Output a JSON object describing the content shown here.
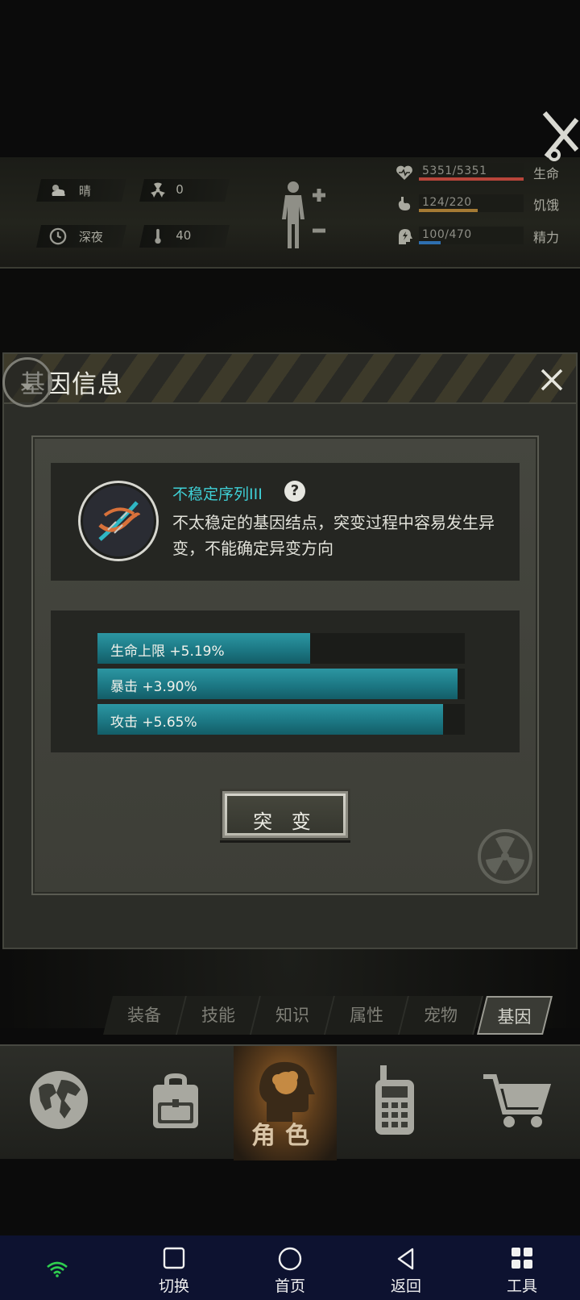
{
  "hud": {
    "weather": "晴",
    "radiation": "0",
    "time_of_day": "深夜",
    "temperature": "40",
    "life": {
      "value": "5351/5351",
      "label": "生命",
      "fill": 1.0,
      "color": "#b8453a"
    },
    "hunger": {
      "value": "124/220",
      "label": "饥饿",
      "fill": 0.56,
      "color": "#a47a34"
    },
    "energy": {
      "value": "100/470",
      "label": "精力",
      "fill": 0.21,
      "color": "#2e6fb0"
    }
  },
  "dialog": {
    "title": "基因信息",
    "gene": {
      "name": "不稳定序列III",
      "description": "不太稳定的基因结点，突变过程中容易发生异变，不能确定异变方向"
    },
    "stats": [
      {
        "label": "生命上限 +5.19%",
        "fill": 0.58
      },
      {
        "label": "暴击 +3.90%",
        "fill": 0.98
      },
      {
        "label": "攻击 +5.65%",
        "fill": 0.94
      }
    ],
    "mutate_label": "突 变"
  },
  "tabs": [
    {
      "label": "装备"
    },
    {
      "label": "技能"
    },
    {
      "label": "知识"
    },
    {
      "label": "属性"
    },
    {
      "label": "宠物"
    },
    {
      "label": "基因",
      "active": true
    }
  ],
  "bottom_nav": {
    "character_label": "角色"
  },
  "system_bar": {
    "switch": "切换",
    "home": "首页",
    "back": "返回",
    "tools": "工具"
  }
}
